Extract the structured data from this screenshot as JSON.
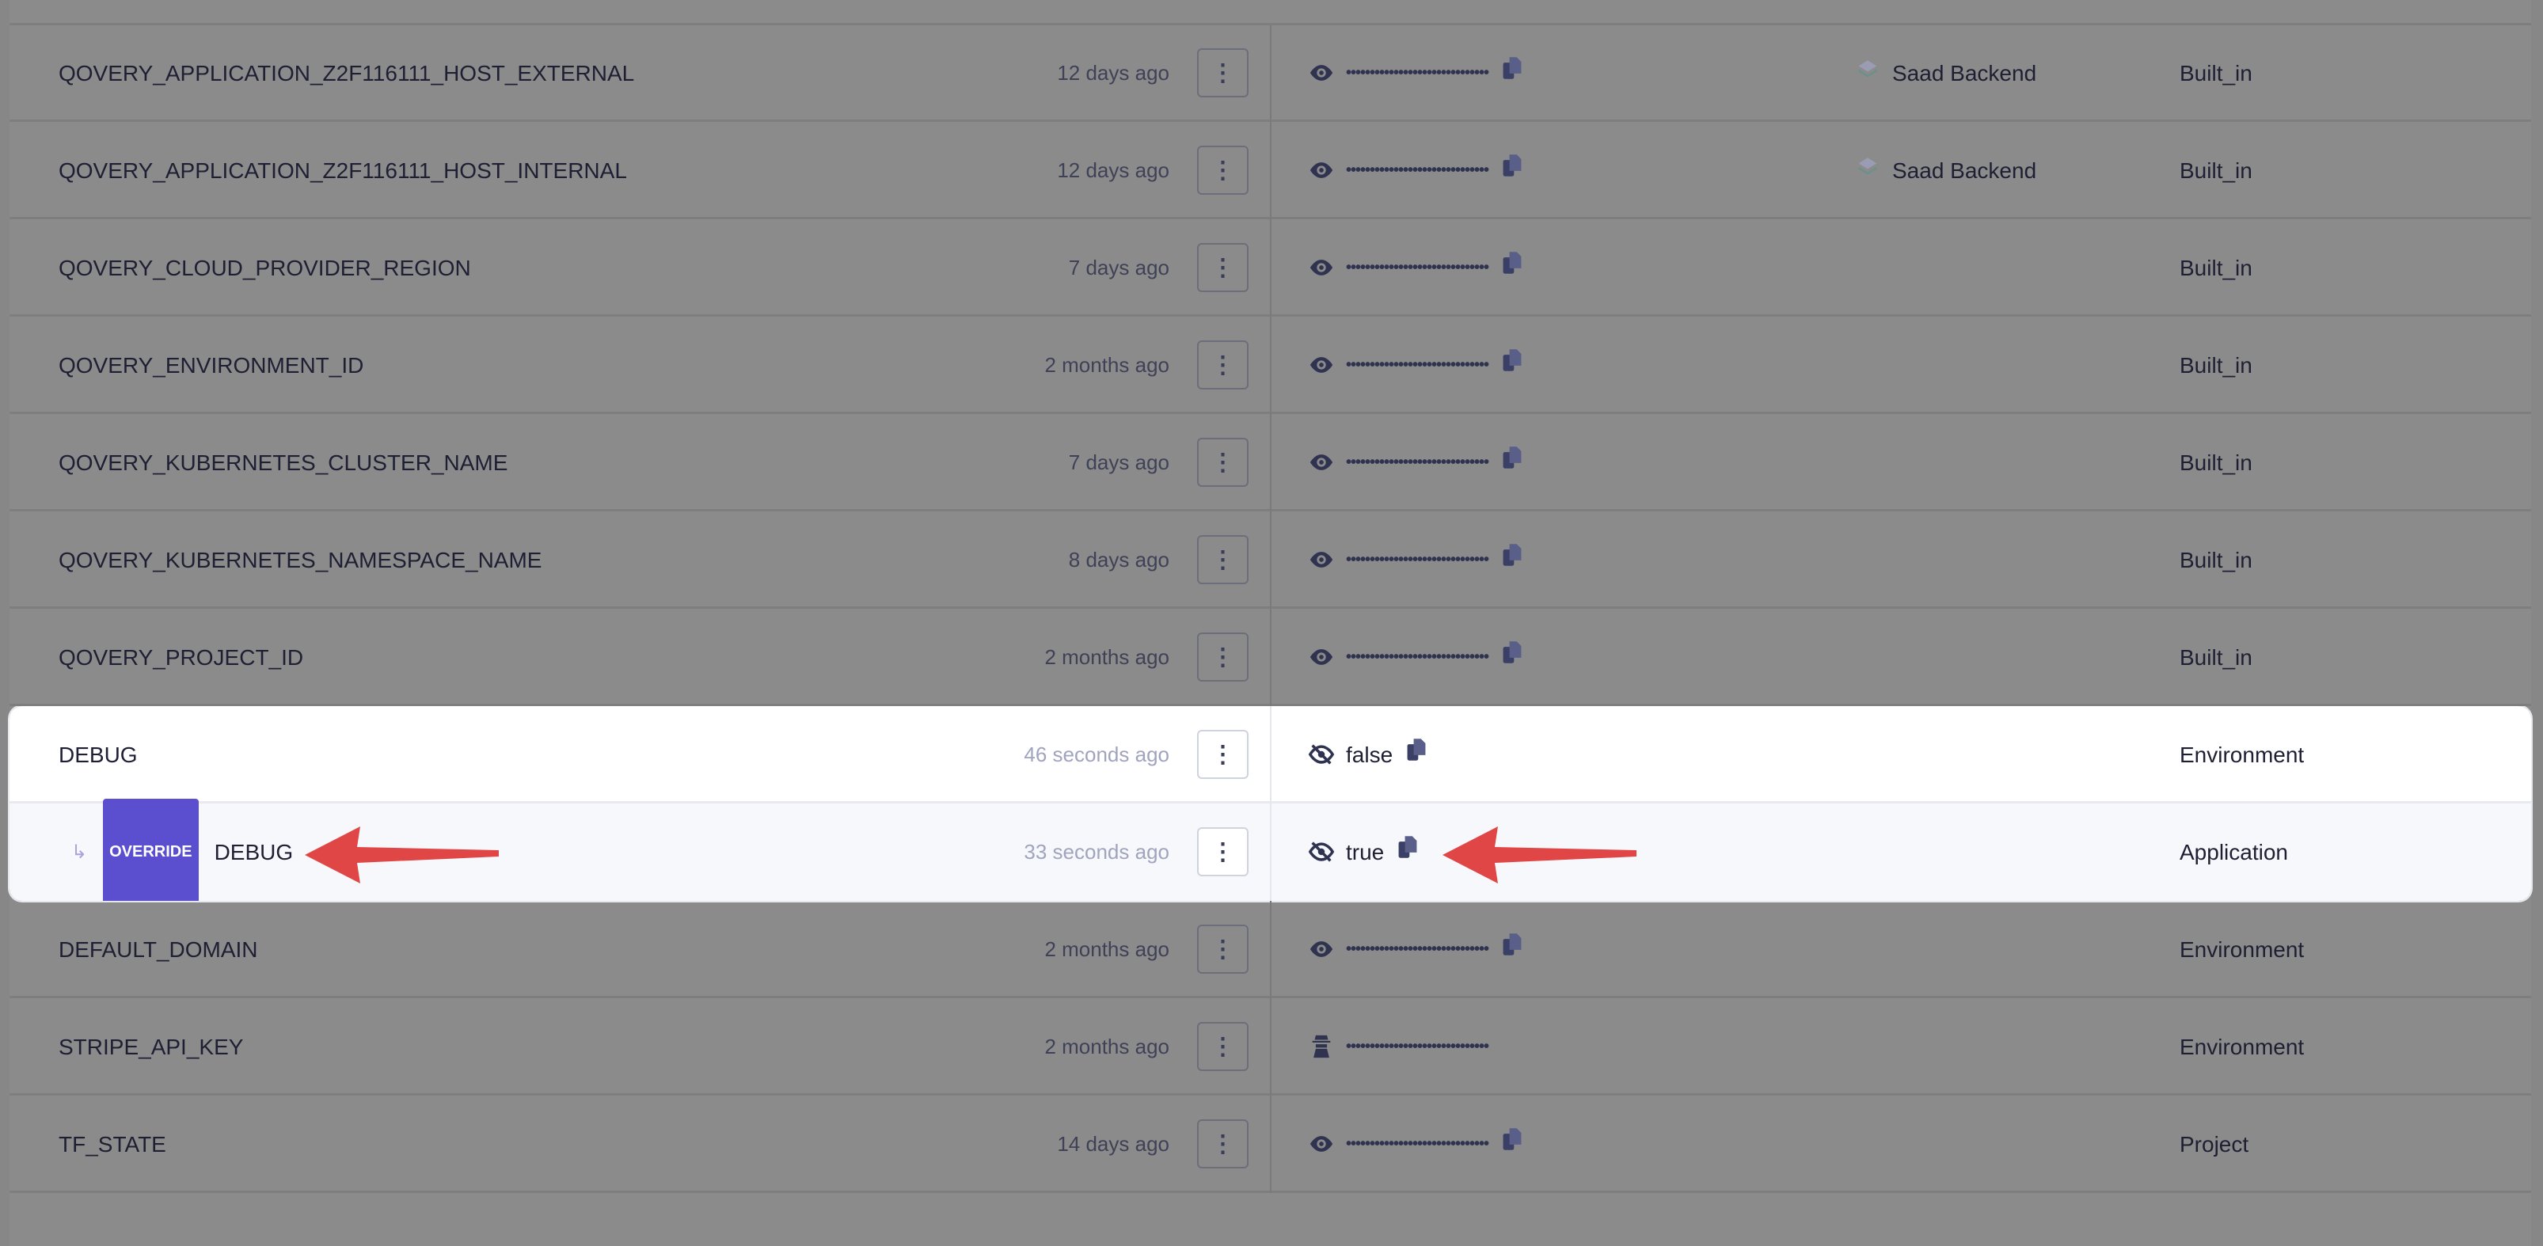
{
  "rows": [
    {
      "name": "QOVERY_APPLICATION_Z2F116111_HOST_EXTERNAL",
      "time": "12 days ago",
      "value_icon": "eye-icon",
      "value": "••••••••••••••••••••••••••••••",
      "copy": true,
      "service": "Saad Backend",
      "scope": "Built_in"
    },
    {
      "name": "QOVERY_APPLICATION_Z2F116111_HOST_INTERNAL",
      "time": "12 days ago",
      "value_icon": "eye-icon",
      "value": "••••••••••••••••••••••••••••••",
      "copy": true,
      "service": "Saad Backend",
      "scope": "Built_in"
    },
    {
      "name": "QOVERY_CLOUD_PROVIDER_REGION",
      "time": "7 days ago",
      "value_icon": "eye-icon",
      "value": "••••••••••••••••••••••••••••••",
      "copy": true,
      "service": "",
      "scope": "Built_in"
    },
    {
      "name": "QOVERY_ENVIRONMENT_ID",
      "time": "2 months ago",
      "value_icon": "eye-icon",
      "value": "••••••••••••••••••••••••••••••",
      "copy": true,
      "service": "",
      "scope": "Built_in"
    },
    {
      "name": "QOVERY_KUBERNETES_CLUSTER_NAME",
      "time": "7 days ago",
      "value_icon": "eye-icon",
      "value": "••••••••••••••••••••••••••••••",
      "copy": true,
      "service": "",
      "scope": "Built_in"
    },
    {
      "name": "QOVERY_KUBERNETES_NAMESPACE_NAME",
      "time": "8 days ago",
      "value_icon": "eye-icon",
      "value": "••••••••••••••••••••••••••••••",
      "copy": true,
      "service": "",
      "scope": "Built_in"
    },
    {
      "name": "QOVERY_PROJECT_ID",
      "time": "2 months ago",
      "value_icon": "eye-icon",
      "value": "••••••••••••••••••••••••••••••",
      "copy": true,
      "service": "",
      "scope": "Built_in"
    }
  ],
  "highlight": [
    {
      "name": "DEBUG",
      "time": "46 seconds ago",
      "value_icon": "eye-slash-icon",
      "value": "false",
      "scope": "Environment"
    },
    {
      "badge": "OVERRIDE",
      "name": "DEBUG",
      "time": "33 seconds ago",
      "value_icon": "eye-slash-icon",
      "value": "true",
      "scope": "Application"
    }
  ],
  "rows_after": [
    {
      "name": "DEFAULT_DOMAIN",
      "time": "2 months ago",
      "value_icon": "eye-icon",
      "value": "••••••••••••••••••••••••••••••",
      "copy": true,
      "scope": "Environment"
    },
    {
      "name": "STRIPE_API_KEY",
      "time": "2 months ago",
      "value_icon": "secret-agent-icon",
      "value": "••••••••••••••••••••••••••••••",
      "copy": false,
      "scope": "Environment"
    },
    {
      "name": "TF_STATE",
      "time": "14 days ago",
      "value_icon": "eye-icon",
      "value": "••••••••••••••••••••••••••••••",
      "copy": true,
      "scope": "Project"
    }
  ],
  "menu_glyph": "⋮",
  "return_glyph": "↳",
  "colors": {
    "overlay": "#8b8b8b",
    "badge": "#5b4fd0",
    "arrow": "#e04646",
    "text": "#1e1f33"
  }
}
